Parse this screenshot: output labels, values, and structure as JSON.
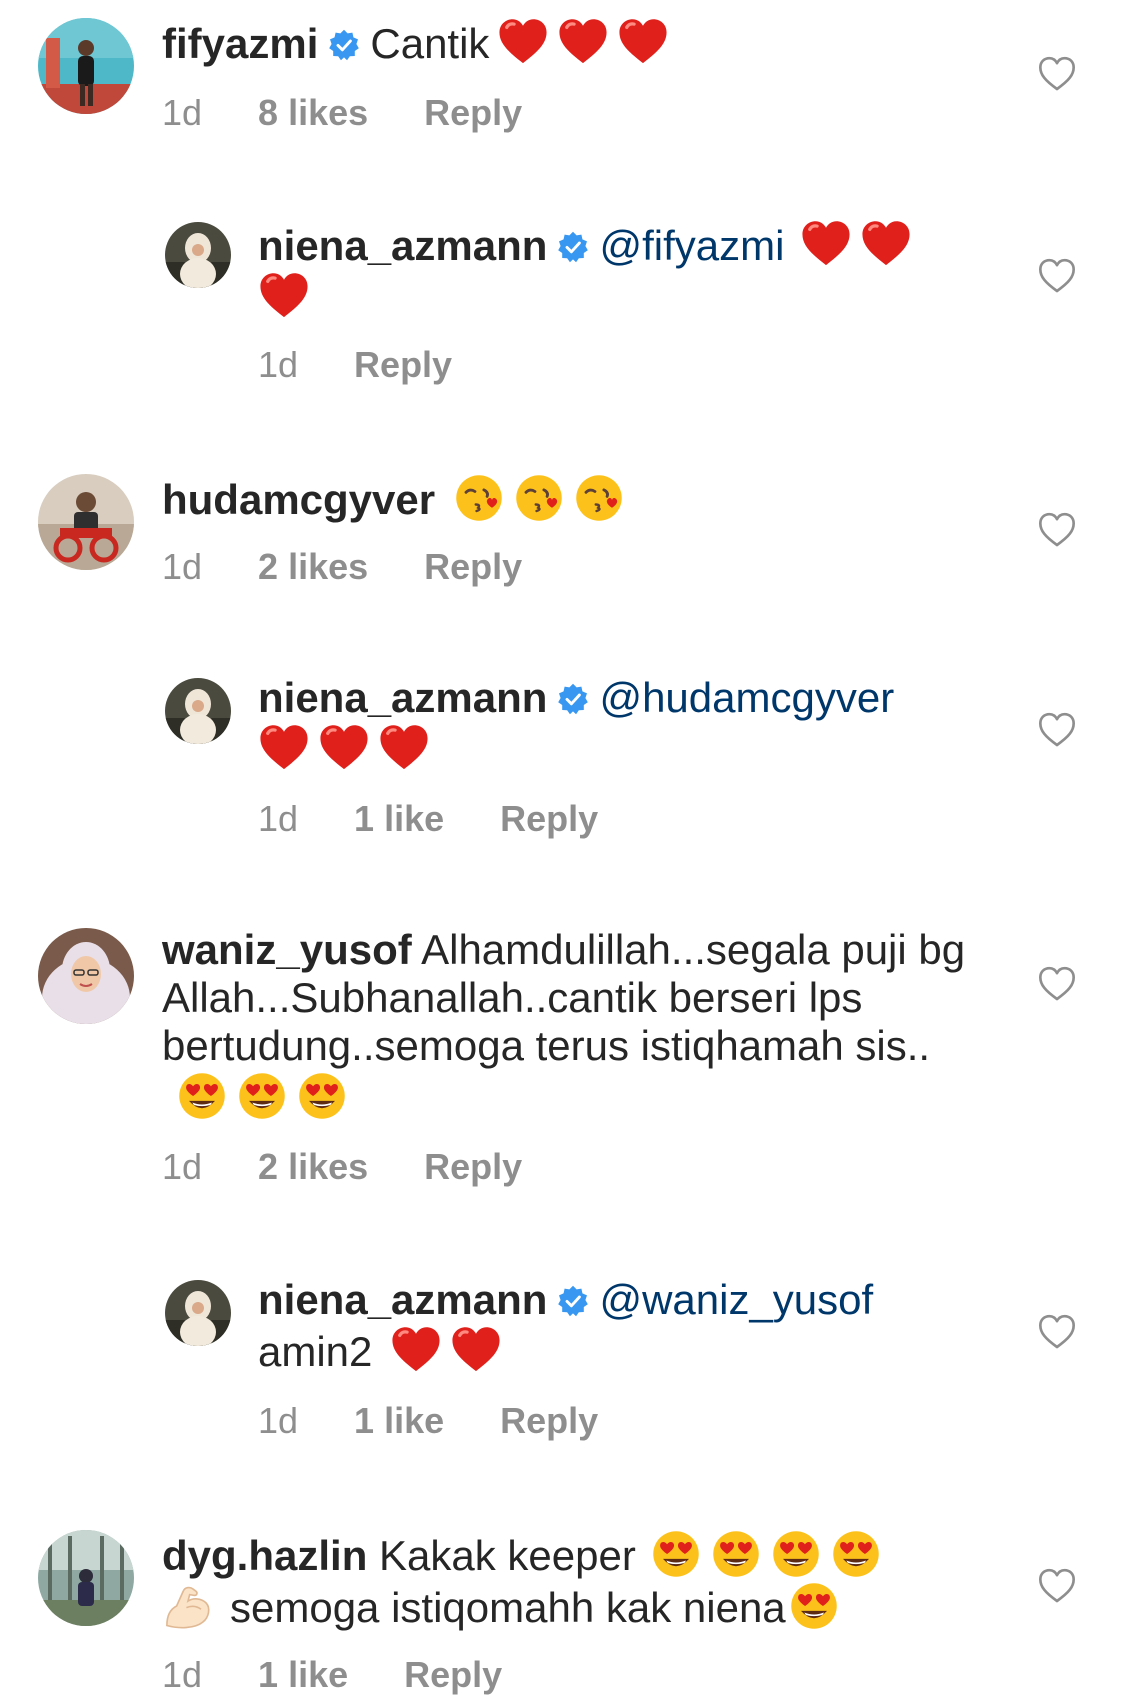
{
  "comments": [
    {
      "username": "fifyazmi",
      "mention": "",
      "text": "Cantik",
      "emoji_name": "red-heart",
      "emoji_count": 3,
      "time": "1d",
      "likes": "8 likes",
      "reply_label": "Reply"
    },
    {
      "username": "niena_azmann",
      "mention": "@fifyazmi",
      "text": "",
      "emoji_name": "red-heart",
      "emoji_count": 3,
      "time": "1d",
      "likes": "",
      "reply_label": "Reply"
    },
    {
      "username": "hudamcgyver",
      "mention": "",
      "text": "",
      "emoji_name": "face-blowing-a-kiss",
      "emoji_count": 3,
      "time": "1d",
      "likes": "2 likes",
      "reply_label": "Reply"
    },
    {
      "username": "niena_azmann",
      "mention": "@hudamcgyver",
      "text": "",
      "emoji_name": "red-heart",
      "emoji_count": 3,
      "time": "1d",
      "likes": "1 like",
      "reply_label": "Reply"
    },
    {
      "username": "waniz_yusof",
      "mention": "",
      "text": "Alhamdulillah...segala puji bg Allah...Subhanallah..cantik berseri lps bertudung..semoga terus istiqhamah sis..",
      "emoji_name": "smiling-face-with-heart-eyes",
      "emoji_count": 3,
      "time": "1d",
      "likes": "2 likes",
      "reply_label": "Reply"
    },
    {
      "username": "niena_azmann",
      "mention": "@waniz_yusof",
      "text": "amin2",
      "emoji_name": "red-heart",
      "emoji_count": 2,
      "time": "1d",
      "likes": "1 like",
      "reply_label": "Reply"
    },
    {
      "username": "dyg.hazlin",
      "mention": "",
      "text_part1": "Kakak keeper",
      "text_part2": "semoga istiqomahh kak niena",
      "emoji_name": "smiling-face-with-heart-eyes",
      "emoji2_name": "flexed-biceps",
      "time": "1d",
      "likes": "1 like",
      "reply_label": "Reply"
    }
  ],
  "icons": {
    "like": "heart-outline-icon",
    "verified": "verified-badge-icon"
  },
  "colors": {
    "username": "#262626",
    "mention": "#00376b",
    "meta": "#8e8e8e",
    "verified": "#3897f0",
    "heart_emoji": "#e0201b"
  }
}
